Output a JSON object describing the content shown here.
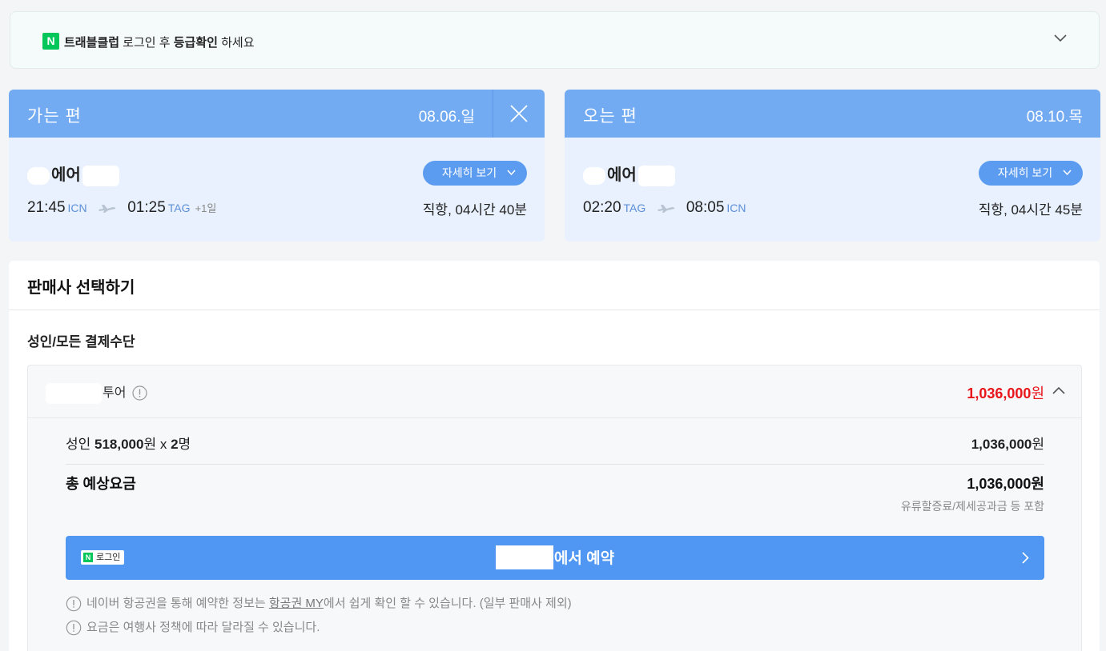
{
  "banner": {
    "brand_badge": "N",
    "club_name": "트래블클럽",
    "prefix_text": " 로그인 후 ",
    "grade_text": "등급확인",
    "suffix_text": " 하세요",
    "icon": "chevron-down-icon"
  },
  "outbound": {
    "direction_label": "가는 편",
    "date": "08.06.일",
    "airline_suffix": "에어",
    "detail_button": "자세히 보기",
    "depart_time": "21:45",
    "depart_code": "ICN",
    "arrive_time": "01:25",
    "arrive_code": "TAG",
    "day_offset": "+1일",
    "duration": "직항, 04시간 40분"
  },
  "inbound": {
    "direction_label": "오는 편",
    "date": "08.10.목",
    "airline_suffix": "에어",
    "detail_button": "자세히 보기",
    "depart_time": "02:20",
    "depart_code": "TAG",
    "arrive_time": "08:05",
    "arrive_code": "ICN",
    "duration": "직항, 04시간 45분"
  },
  "seller": {
    "title": "판매사 선택하기",
    "category": "성인/모든 결제수단",
    "agency": {
      "name_suffix": "투어",
      "price": "1,036,000",
      "price_unit": "원",
      "adult_label": "성인 ",
      "unit_price": "518,000",
      "unit_won": "원 x ",
      "count": "2",
      "count_unit": "명",
      "subtotal": "1,036,000",
      "subtotal_unit": "원",
      "total_label": "총 예상요금",
      "total": "1,036,000원",
      "total_note": "유류할증료/제세공과금 등 포함",
      "login_badge": "로그인",
      "login_n": "N",
      "book_suffix": "에서 예약",
      "notice1_pre": "네이버 항공권을 통해 예약한 정보는 ",
      "notice1_link": "항공권 MY",
      "notice1_post": "에서 쉽게 확인 할 수 있습니다. (일부 판매사 제외)",
      "notice2": "요금은 여행사 정책에 따라 달라질 수 있습니다."
    }
  },
  "colors": {
    "header_blue": "#73abf3",
    "card_bg": "#e8f1fd",
    "accent_blue": "#4f97f2",
    "price_red": "#e8151b",
    "naver_green": "#03c75a"
  }
}
